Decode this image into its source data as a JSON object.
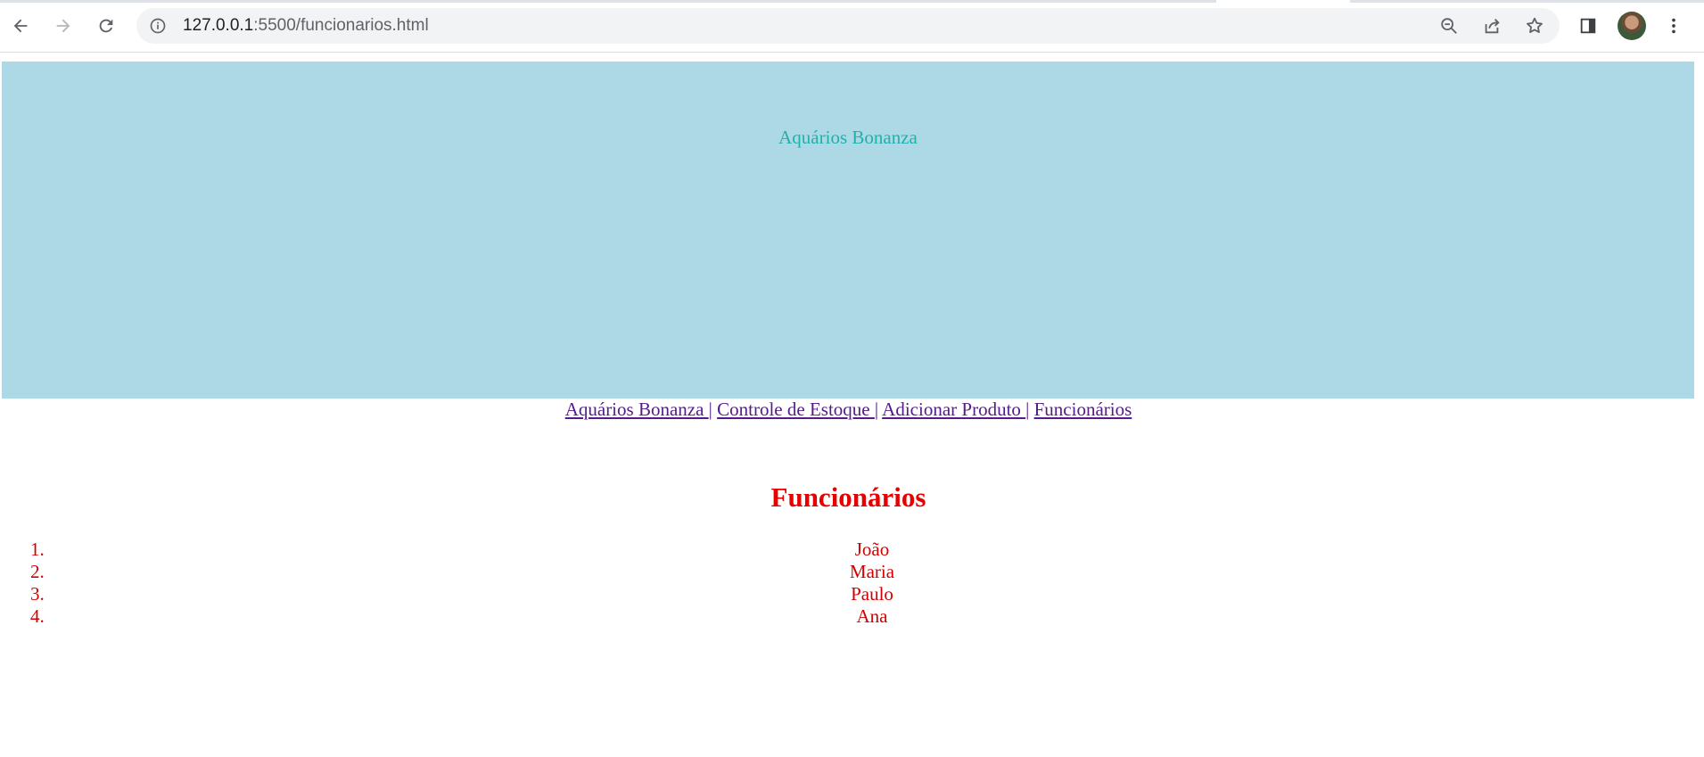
{
  "browser": {
    "url_host": "127.0.0.1",
    "url_path": ":5500/funcionarios.html"
  },
  "page": {
    "banner_title": "Aquários Bonanza",
    "nav": [
      {
        "label": "Aquários Bonanza "
      },
      {
        "label": "Controle de Estoque "
      },
      {
        "label": "Adicionar Produto "
      },
      {
        "label": "Funcionários"
      }
    ],
    "nav_separator": "|",
    "heading": "Funcionários",
    "employees": [
      {
        "num": "1.",
        "name": "João"
      },
      {
        "num": "2.",
        "name": "Maria"
      },
      {
        "num": "3.",
        "name": "Paulo"
      },
      {
        "num": "4.",
        "name": "Ana"
      }
    ]
  },
  "colors": {
    "banner_bg": "#add8e6",
    "banner_title": "#20b2aa",
    "link": "#551a8b",
    "heading": "#e60000",
    "list_text": "#d40000"
  }
}
